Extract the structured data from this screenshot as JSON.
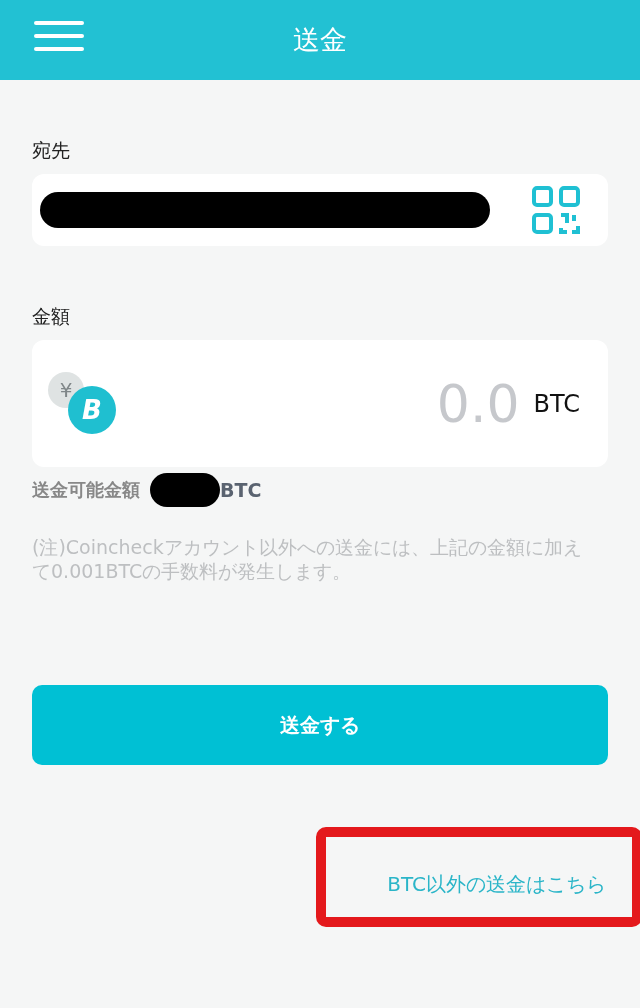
{
  "header": {
    "title": "送金"
  },
  "address": {
    "label": "宛先",
    "redacted": true
  },
  "amount": {
    "label": "金額",
    "yen_glyph": "¥",
    "coin_glyph": "B",
    "value": "0.0",
    "unit": "BTC"
  },
  "available": {
    "label": "送金可能金額",
    "redacted": true,
    "unit": "BTC"
  },
  "note": "(注)Coincheckアカウント以外への送金には、上記の金額に加えて0.001BTCの手数料が発生します。",
  "submit_button": "送金する",
  "other_link": {
    "label": "BTC以外の送金はこちら",
    "highlighted": true
  }
}
